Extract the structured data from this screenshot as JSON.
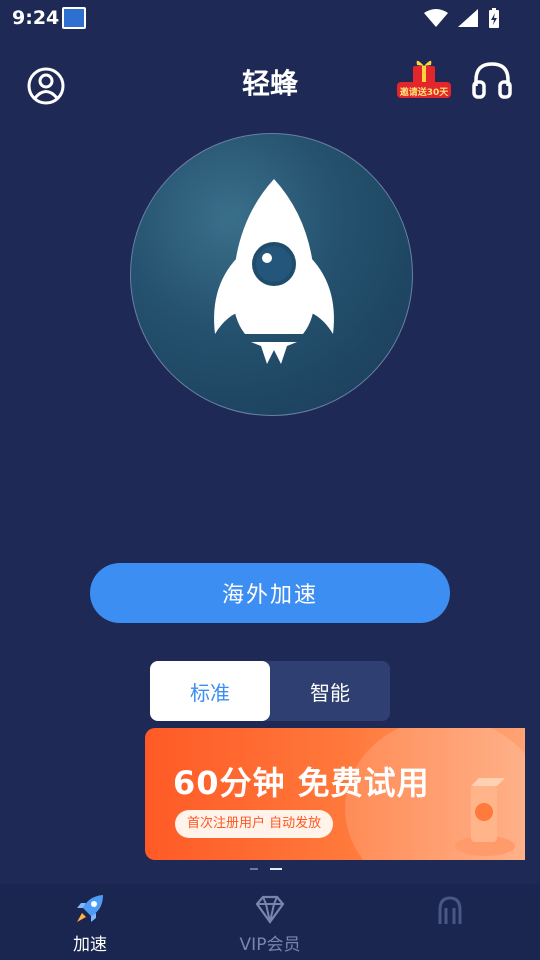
{
  "status_bar": {
    "time": "9:24"
  },
  "header": {
    "title": "轻蜂",
    "gift_badge_text": "邀请送30天"
  },
  "main": {
    "connect_button_label": "海外加速"
  },
  "mode_toggle": {
    "options": [
      "标准",
      "智能"
    ],
    "selected": "标准"
  },
  "banner": {
    "title": "60分钟 免费试用",
    "subtitle": "首次注册用户 自动发放"
  },
  "pager": {
    "count": 2,
    "active_index": 1
  },
  "bottom_nav": {
    "items": [
      {
        "label": "加速",
        "active": true
      },
      {
        "label": "VIP会员",
        "active": false
      },
      {
        "label": "",
        "active": false
      }
    ]
  },
  "colors": {
    "background": "#1e2a55",
    "accent": "#3d8ef2",
    "banner": "#ff5a26"
  }
}
